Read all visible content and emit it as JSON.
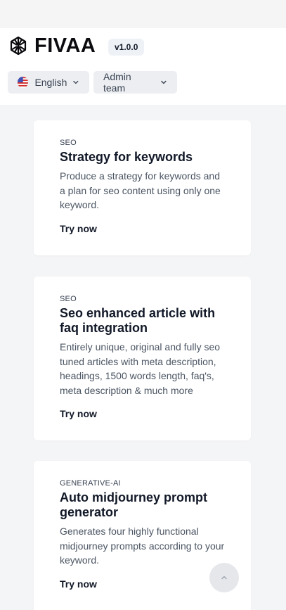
{
  "app": {
    "name": "FIVAA",
    "version": "v1.0.0",
    "brand_color": "#0b0b0f"
  },
  "header": {
    "language": {
      "label": "English",
      "flag_icon": "us-flag-icon"
    },
    "team": {
      "label": "Admin team"
    }
  },
  "cards": [
    {
      "category": "SEO",
      "title": "Strategy for keywords",
      "description": "Produce a strategy for keywords and a plan for seo content using only one keyword.",
      "cta": "Try now"
    },
    {
      "category": "SEO",
      "title": "Seo enhanced article with faq integration",
      "description": "Entirely unique, original and fully seo tuned articles with meta description, headings, 1500 words length, faq's, meta description & much more",
      "cta": "Try now"
    },
    {
      "category": "GENERATIVE-AI",
      "title": "Auto midjourney prompt generator",
      "description": "Generates four highly functional midjourney prompts according to your keyword.",
      "cta": "Try now"
    }
  ],
  "icons": {
    "logo": "fivaa-logo-icon",
    "chevron": "chevron-down-icon",
    "scroll_top": "chevron-up-icon"
  }
}
